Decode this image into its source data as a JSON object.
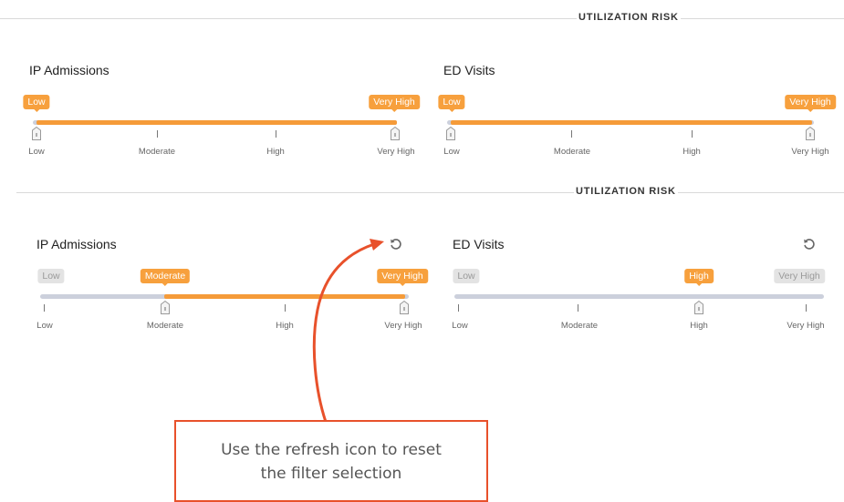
{
  "sections": [
    {
      "title": "UTILIZATION RISK",
      "filters": [
        {
          "title": "IP Admissions",
          "tags": [
            "Low",
            "Very High"
          ],
          "ticks": [
            "Low",
            "Moderate",
            "High",
            "Very High"
          ]
        },
        {
          "title": "ED Visits",
          "tags": [
            "Low",
            "Very High"
          ],
          "ticks": [
            "Low",
            "Moderate",
            "High",
            "Very High"
          ]
        }
      ]
    },
    {
      "title": "UTILIZATION RISK",
      "filters": [
        {
          "title": "IP Admissions",
          "tags": [
            "Low",
            "Moderate",
            "Very High"
          ],
          "ticks": [
            "Low",
            "Moderate",
            "High",
            "Very High"
          ],
          "selected_range": [
            "Moderate",
            "Very High"
          ]
        },
        {
          "title": "ED Visits",
          "tags": [
            "Low",
            "High",
            "Very High"
          ],
          "ticks": [
            "Low",
            "Moderate",
            "High",
            "Very High"
          ],
          "selected_range": [
            "High",
            "High"
          ]
        }
      ]
    }
  ],
  "callout": {
    "line1": "Use the refresh icon to reset",
    "line2": "the filter selection"
  },
  "icons": {
    "refresh": "refresh-icon",
    "handle": "slider-handle-icon"
  },
  "colors": {
    "accent": "#f7a03d",
    "track": "#ccd0dc",
    "annotation": "#e8512b"
  }
}
